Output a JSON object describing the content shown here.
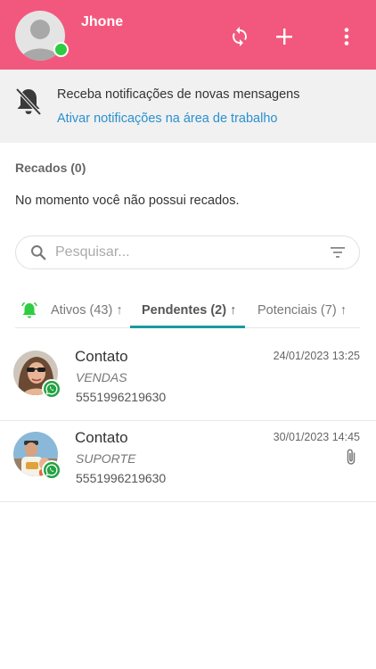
{
  "header": {
    "user_name": "Jhone",
    "status": "online",
    "icons": [
      "sync-icon",
      "plus-icon",
      "more-vert-icon"
    ],
    "color": "#f2587d"
  },
  "notification": {
    "title": "Receba notificações de novas mensagens",
    "link": "Ativar notificações na área de trabalho",
    "icon": "bell-off-icon"
  },
  "recados": {
    "title": "Recados (0)",
    "empty_text": "No momento você não possui recados."
  },
  "search": {
    "placeholder": "Pesquisar...",
    "value": ""
  },
  "tabs": [
    {
      "label": "Ativos (43)",
      "arrow": "↑",
      "active": false
    },
    {
      "label": "Pendentes (2)",
      "arrow": "↑",
      "active": true
    },
    {
      "label": "Potenciais (7)",
      "arrow": "↑",
      "active": false
    }
  ],
  "contacts": [
    {
      "name": "Contato",
      "department": "VENDAS",
      "phone": "5551996219630",
      "datetime": "24/01/2023 13:25",
      "channel": "whatsapp",
      "attachment": false
    },
    {
      "name": "Contato",
      "department": "SUPORTE",
      "phone": "5551996219630",
      "datetime": "30/01/2023 14:45",
      "channel": "whatsapp",
      "attachment": true
    }
  ],
  "colors": {
    "accent": "#f2587d",
    "link": "#2a90cf",
    "tab_active": "#1a9aa0",
    "whatsapp": "#25a244",
    "online": "#2ecc40"
  }
}
